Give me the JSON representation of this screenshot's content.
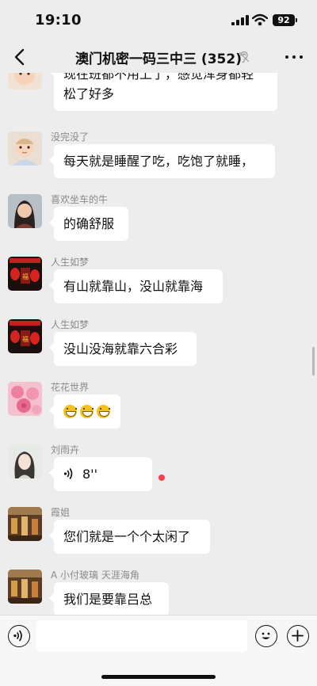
{
  "status_bar": {
    "time": "19:10",
    "battery": "92"
  },
  "nav": {
    "title": "澳门机密一码三中三 (352)"
  },
  "messages": [
    {
      "sender": "",
      "lines": [
        "现在班都不用上了，感觉浑身都轻",
        "松了好多"
      ],
      "avatar": "baby-avatar"
    },
    {
      "sender": "没完没了",
      "text": "每天就是睡醒了吃，吃饱了就睡，",
      "avatar": "baby-avatar"
    },
    {
      "sender": "喜欢坐车的牛",
      "text": "的确舒服",
      "avatar": "woman-avatar"
    },
    {
      "sender": "人生如梦",
      "text": "有山就靠山，没山就靠海",
      "avatar": "red-lantern-avatar"
    },
    {
      "sender": "人生如梦",
      "text": "没山没海就靠六合彩",
      "avatar": "red-lantern-avatar"
    },
    {
      "sender": "花花世界",
      "emojis": [
        "grin-emoji",
        "grin-emoji",
        "grin-emoji"
      ],
      "avatar": "roses-avatar"
    },
    {
      "sender": "刘雨卉",
      "voice_duration": "8''",
      "avatar": "illustrated-woman-avatar"
    },
    {
      "sender": "霞姐",
      "text": "您们就是一个个太闲了",
      "avatar": "market-avatar"
    },
    {
      "sender": "A 小付玻璃  天涯海角",
      "text": "我们是要靠吕总",
      "avatar": "market-avatar"
    }
  ],
  "colors": {
    "chat_bg": "#ededed",
    "bubble_bg": "#ffffff",
    "unread_dot": "#f3414b"
  }
}
